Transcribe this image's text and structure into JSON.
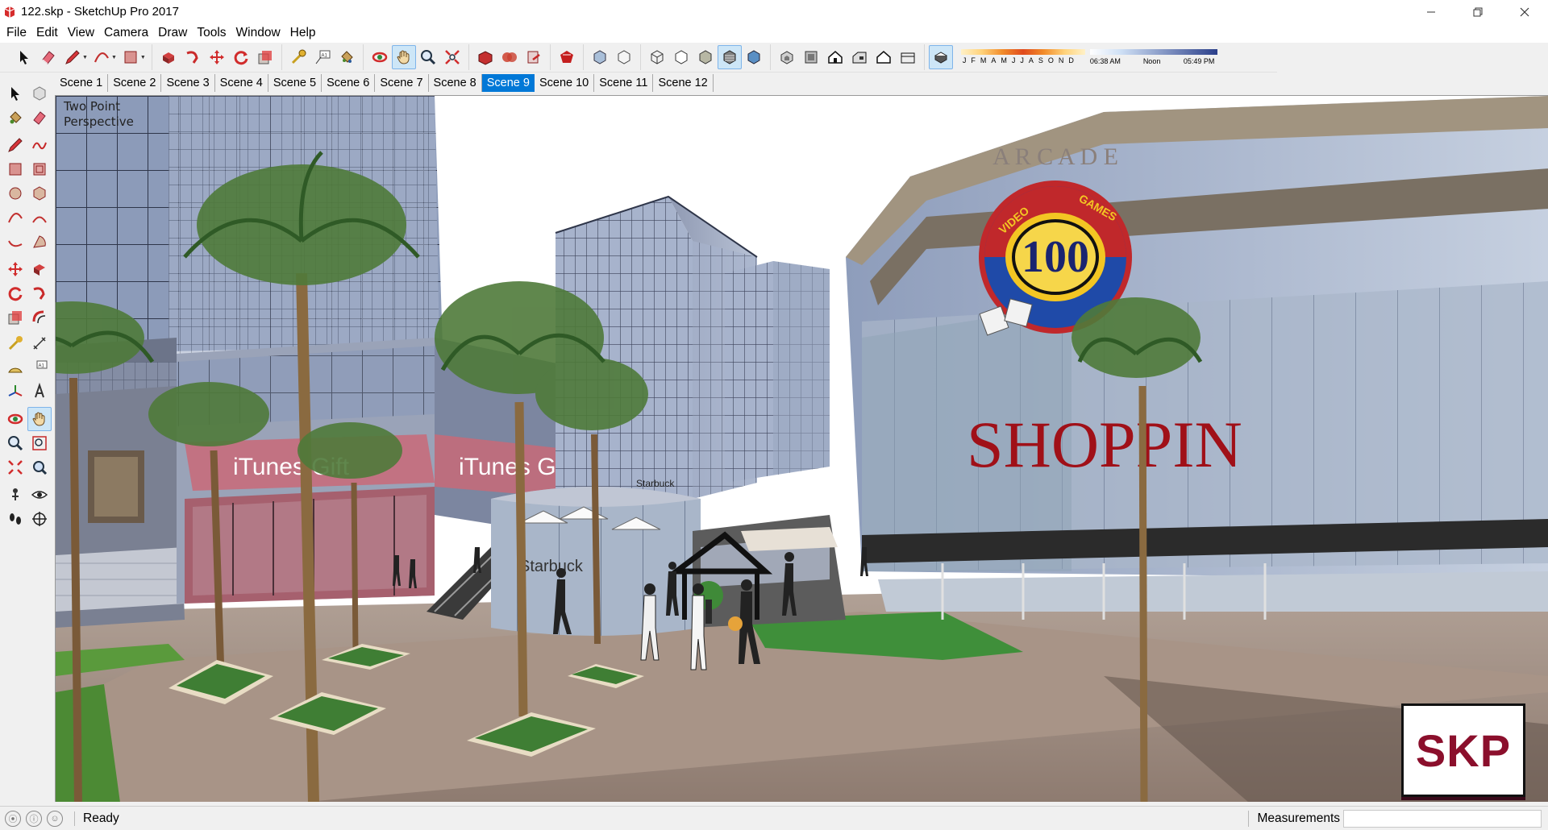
{
  "window": {
    "title": "122.skp - SketchUp Pro 2017",
    "minimize_icon": "minimize-icon",
    "maximize_icon": "restore-icon",
    "close_icon": "close-icon"
  },
  "menu": {
    "items": [
      "File",
      "Edit",
      "View",
      "Camera",
      "Draw",
      "Tools",
      "Window",
      "Help"
    ]
  },
  "shadow": {
    "months": [
      "J",
      "F",
      "M",
      "A",
      "M",
      "J",
      "J",
      "A",
      "S",
      "O",
      "N",
      "D"
    ],
    "time_start": "06:38 AM",
    "time_mid": "Noon",
    "time_end": "05:49 PM"
  },
  "scenes": {
    "tabs": [
      "Scene 1",
      "Scene 2",
      "Scene 3",
      "Scene 4",
      "Scene 5",
      "Scene 6",
      "Scene 7",
      "Scene 8",
      "Scene 9",
      "Scene 10",
      "Scene 11",
      "Scene 12"
    ],
    "active_index": 8
  },
  "viewport": {
    "camera_label_line1": "Two Point",
    "camera_label_line2": "Perspective",
    "sign_itunes": "iTunes Gift",
    "sign_starbuck": "Starbuck",
    "sign_shopping": "SHOPPIN",
    "sign_arcade_number": "100",
    "sign_arcade_ring_top": "A R C A D E",
    "sign_arcade_video": "VIDEO",
    "sign_arcade_games": "GAMES",
    "watermark": "SKP"
  },
  "status": {
    "text": "Ready",
    "measurements_label": "Measurements",
    "measurements_value": ""
  },
  "colors": {
    "accent": "#0078d7",
    "sky": "#ffffff",
    "glass": "#9aa8c4",
    "ground": "#a08e80"
  }
}
